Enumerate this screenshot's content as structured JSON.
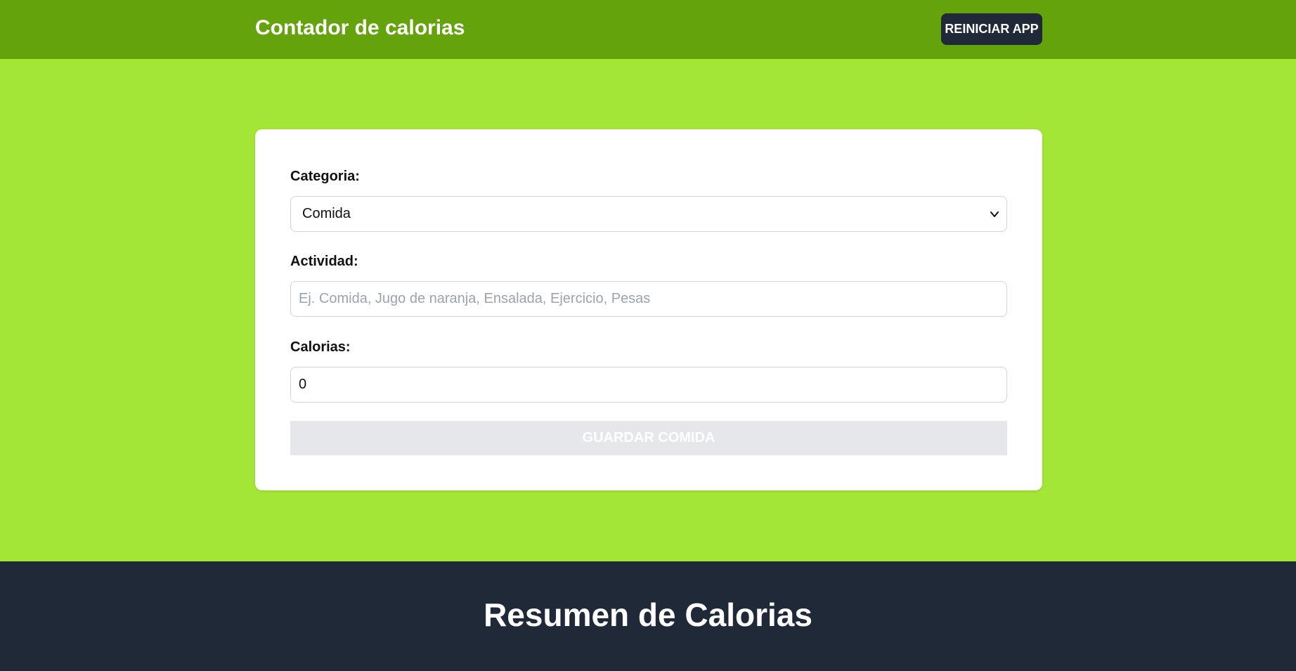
{
  "header": {
    "title": "Contador de calorias",
    "reset_label": "Reiniciar App"
  },
  "form": {
    "categoria_label": "Categoria:",
    "categoria_selected": "Comida",
    "actividad_label": "Actividad:",
    "actividad_placeholder": "Ej. Comida, Jugo de naranja, Ensalada, Ejercicio, Pesas",
    "actividad_value": "",
    "calorias_label": "Calorias:",
    "calorias_value": "0",
    "save_label": "Guardar Comida"
  },
  "summary": {
    "title": "Resumen de Calorias"
  },
  "colors": {
    "header_bg": "#65a30d",
    "main_bg": "#a3e635",
    "dark": "#1f2937",
    "disabled_button": "#e5e7eb"
  },
  "icons": {
    "select_arrow": "chevron-down-icon"
  }
}
